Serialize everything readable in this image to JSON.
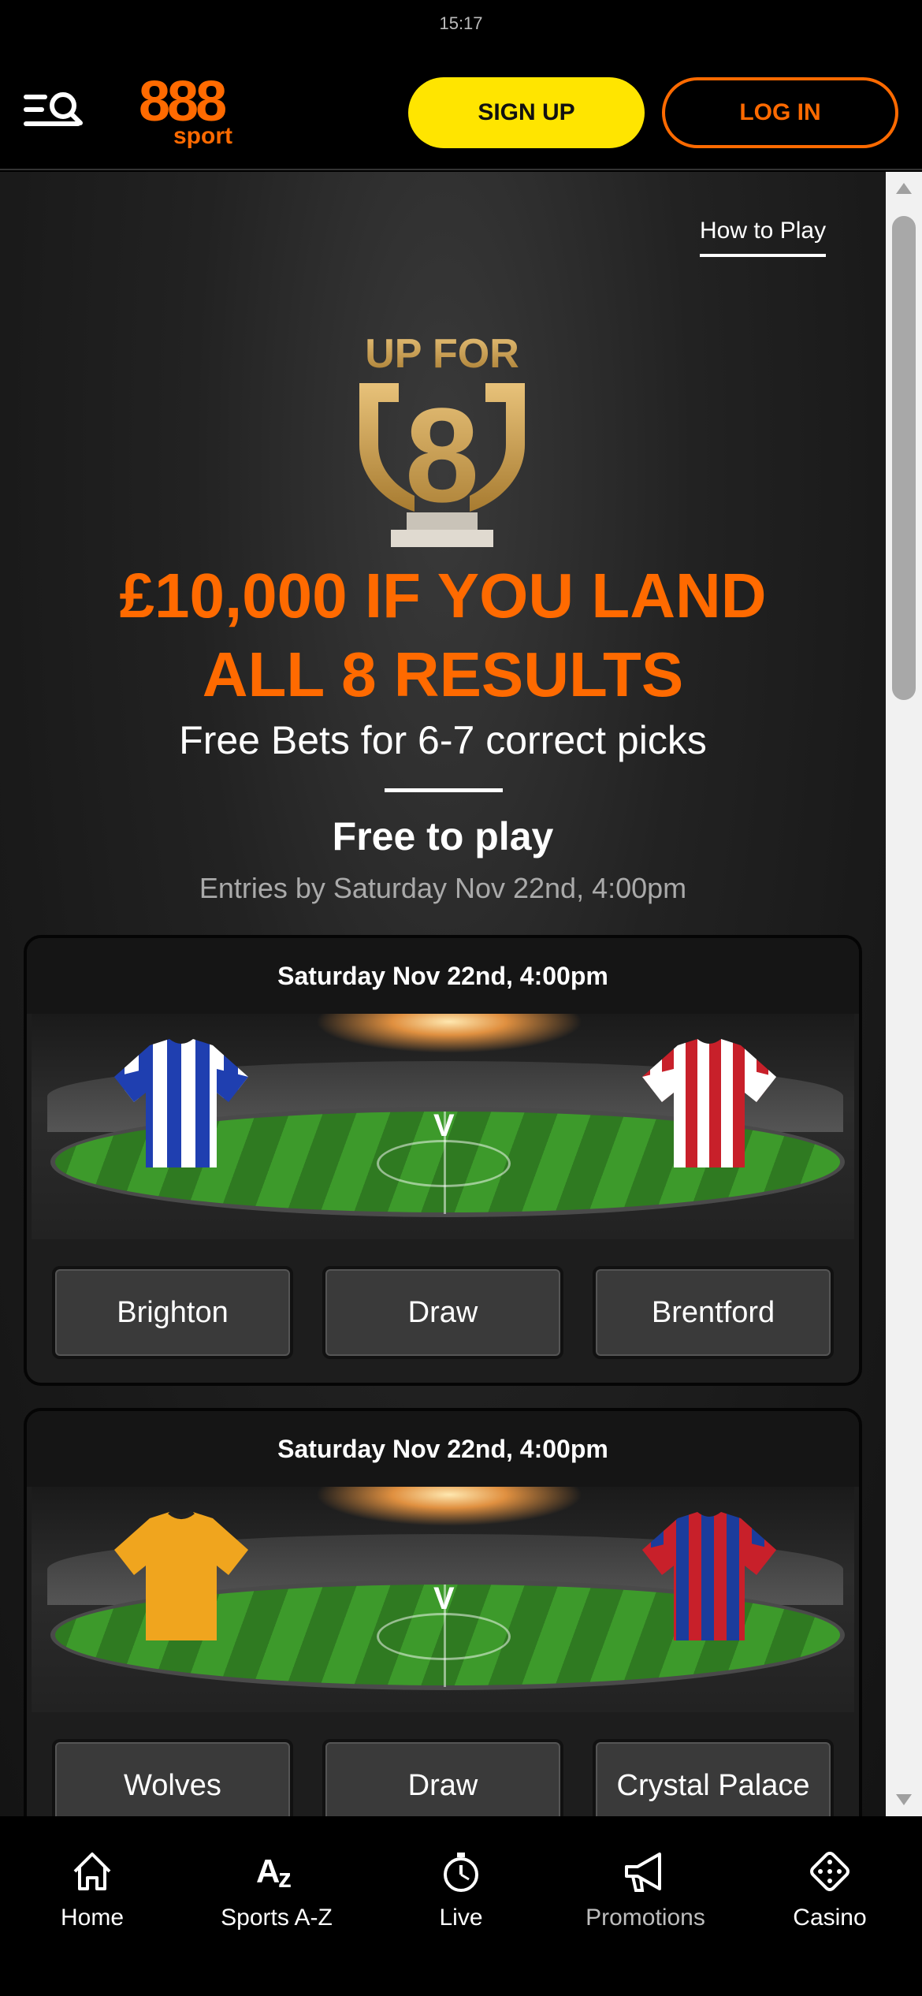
{
  "status": {
    "time": "15:17"
  },
  "header": {
    "logo_number": "888",
    "logo_sub": "sport",
    "signup_label": "SIGN UP",
    "login_label": "LOG IN"
  },
  "promo": {
    "how_to_play": "How to Play",
    "trophy_text_top": "UP FOR",
    "trophy_number": "8",
    "headline_line1": "£10,000 IF YOU LAND",
    "headline_line2": "ALL 8 RESULTS",
    "subline": "Free Bets for 6-7 correct picks",
    "free_to_play": "Free to play",
    "entries": "Entries by Saturday Nov 22nd, 4:00pm"
  },
  "matches": [
    {
      "date": "Saturday Nov 22nd, 4:00pm",
      "vs": "V",
      "options": [
        "Brighton",
        "Draw",
        "Brentford"
      ]
    },
    {
      "date": "Saturday Nov 22nd, 4:00pm",
      "vs": "V",
      "options": [
        "Wolves",
        "Draw",
        "Crystal Palace"
      ]
    }
  ],
  "nav": {
    "items": [
      {
        "label": "Home",
        "icon": "home-icon"
      },
      {
        "label": "Sports A-Z",
        "icon": "az-icon"
      },
      {
        "label": "Live",
        "icon": "stopwatch-icon"
      },
      {
        "label": "Promotions",
        "icon": "megaphone-icon"
      },
      {
        "label": "Casino",
        "icon": "dice-icon"
      }
    ]
  },
  "colors": {
    "brand_orange": "#ff6a00",
    "signup_yellow": "#ffe500"
  }
}
